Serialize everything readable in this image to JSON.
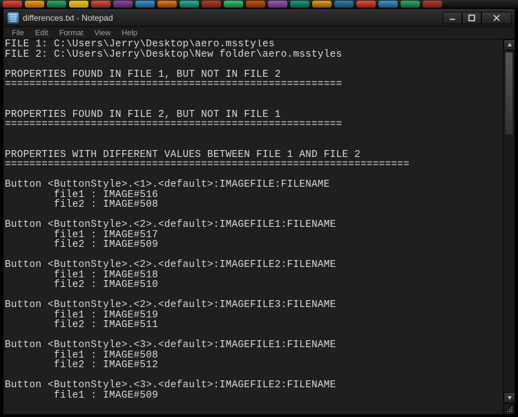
{
  "title": "differences.txt - Notepad",
  "menu": {
    "file": "File",
    "edit": "Edit",
    "format": "Format",
    "view": "View",
    "help": "Help"
  },
  "content": "FILE 1: C:\\Users\\Jerry\\Desktop\\aero.msstyles\nFILE 2: C:\\Users\\Jerry\\Desktop\\New folder\\aero.msstyles\n\nPROPERTIES FOUND IN FILE 1, BUT NOT IN FILE 2\n=======================================================\n\n\nPROPERTIES FOUND IN FILE 2, BUT NOT IN FILE 1\n=======================================================\n\n\nPROPERTIES WITH DIFFERENT VALUES BETWEEN FILE 1 AND FILE 2\n==================================================================\n\nButton <ButtonStyle>.<1>.<default>:IMAGEFILE:FILENAME\n        file1 : IMAGE#516\n        file2 : IMAGE#508\n\nButton <ButtonStyle>.<2>.<default>:IMAGEFILE1:FILENAME\n        file1 : IMAGE#517\n        file2 : IMAGE#509\n\nButton <ButtonStyle>.<2>.<default>:IMAGEFILE2:FILENAME\n        file1 : IMAGE#518\n        file2 : IMAGE#510\n\nButton <ButtonStyle>.<2>.<default>:IMAGEFILE3:FILENAME\n        file1 : IMAGE#519\n        file2 : IMAGE#511\n\nButton <ButtonStyle>.<3>.<default>:IMAGEFILE1:FILENAME\n        file1 : IMAGE#508\n        file2 : IMAGE#512\n\nButton <ButtonStyle>.<3>.<default>:IMAGEFILE2:FILENAME\n        file1 : IMAGE#509"
}
